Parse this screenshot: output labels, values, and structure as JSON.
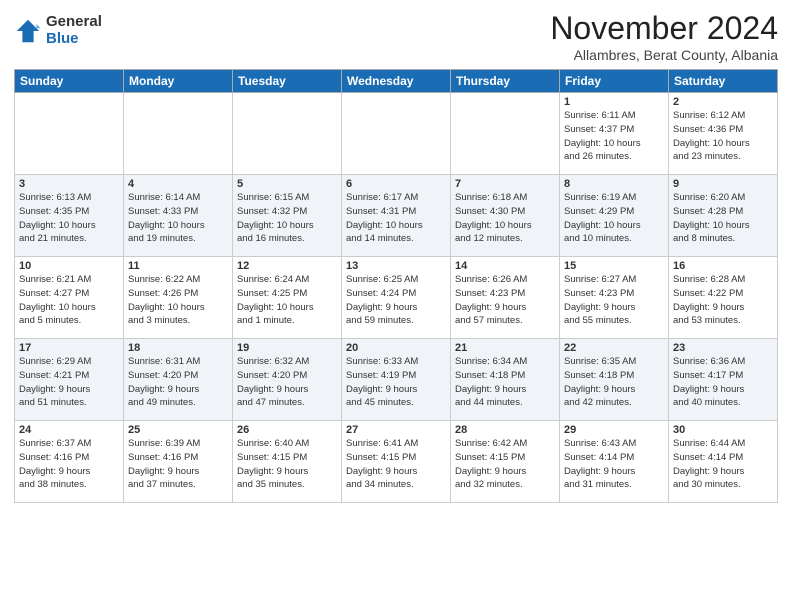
{
  "logo": {
    "general": "General",
    "blue": "Blue"
  },
  "header": {
    "month": "November 2024",
    "location": "Allambres, Berat County, Albania"
  },
  "weekdays": [
    "Sunday",
    "Monday",
    "Tuesday",
    "Wednesday",
    "Thursday",
    "Friday",
    "Saturday"
  ],
  "weeks": [
    [
      {
        "day": "",
        "info": ""
      },
      {
        "day": "",
        "info": ""
      },
      {
        "day": "",
        "info": ""
      },
      {
        "day": "",
        "info": ""
      },
      {
        "day": "",
        "info": ""
      },
      {
        "day": "1",
        "info": "Sunrise: 6:11 AM\nSunset: 4:37 PM\nDaylight: 10 hours\nand 26 minutes."
      },
      {
        "day": "2",
        "info": "Sunrise: 6:12 AM\nSunset: 4:36 PM\nDaylight: 10 hours\nand 23 minutes."
      }
    ],
    [
      {
        "day": "3",
        "info": "Sunrise: 6:13 AM\nSunset: 4:35 PM\nDaylight: 10 hours\nand 21 minutes."
      },
      {
        "day": "4",
        "info": "Sunrise: 6:14 AM\nSunset: 4:33 PM\nDaylight: 10 hours\nand 19 minutes."
      },
      {
        "day": "5",
        "info": "Sunrise: 6:15 AM\nSunset: 4:32 PM\nDaylight: 10 hours\nand 16 minutes."
      },
      {
        "day": "6",
        "info": "Sunrise: 6:17 AM\nSunset: 4:31 PM\nDaylight: 10 hours\nand 14 minutes."
      },
      {
        "day": "7",
        "info": "Sunrise: 6:18 AM\nSunset: 4:30 PM\nDaylight: 10 hours\nand 12 minutes."
      },
      {
        "day": "8",
        "info": "Sunrise: 6:19 AM\nSunset: 4:29 PM\nDaylight: 10 hours\nand 10 minutes."
      },
      {
        "day": "9",
        "info": "Sunrise: 6:20 AM\nSunset: 4:28 PM\nDaylight: 10 hours\nand 8 minutes."
      }
    ],
    [
      {
        "day": "10",
        "info": "Sunrise: 6:21 AM\nSunset: 4:27 PM\nDaylight: 10 hours\nand 5 minutes."
      },
      {
        "day": "11",
        "info": "Sunrise: 6:22 AM\nSunset: 4:26 PM\nDaylight: 10 hours\nand 3 minutes."
      },
      {
        "day": "12",
        "info": "Sunrise: 6:24 AM\nSunset: 4:25 PM\nDaylight: 10 hours\nand 1 minute."
      },
      {
        "day": "13",
        "info": "Sunrise: 6:25 AM\nSunset: 4:24 PM\nDaylight: 9 hours\nand 59 minutes."
      },
      {
        "day": "14",
        "info": "Sunrise: 6:26 AM\nSunset: 4:23 PM\nDaylight: 9 hours\nand 57 minutes."
      },
      {
        "day": "15",
        "info": "Sunrise: 6:27 AM\nSunset: 4:23 PM\nDaylight: 9 hours\nand 55 minutes."
      },
      {
        "day": "16",
        "info": "Sunrise: 6:28 AM\nSunset: 4:22 PM\nDaylight: 9 hours\nand 53 minutes."
      }
    ],
    [
      {
        "day": "17",
        "info": "Sunrise: 6:29 AM\nSunset: 4:21 PM\nDaylight: 9 hours\nand 51 minutes."
      },
      {
        "day": "18",
        "info": "Sunrise: 6:31 AM\nSunset: 4:20 PM\nDaylight: 9 hours\nand 49 minutes."
      },
      {
        "day": "19",
        "info": "Sunrise: 6:32 AM\nSunset: 4:20 PM\nDaylight: 9 hours\nand 47 minutes."
      },
      {
        "day": "20",
        "info": "Sunrise: 6:33 AM\nSunset: 4:19 PM\nDaylight: 9 hours\nand 45 minutes."
      },
      {
        "day": "21",
        "info": "Sunrise: 6:34 AM\nSunset: 4:18 PM\nDaylight: 9 hours\nand 44 minutes."
      },
      {
        "day": "22",
        "info": "Sunrise: 6:35 AM\nSunset: 4:18 PM\nDaylight: 9 hours\nand 42 minutes."
      },
      {
        "day": "23",
        "info": "Sunrise: 6:36 AM\nSunset: 4:17 PM\nDaylight: 9 hours\nand 40 minutes."
      }
    ],
    [
      {
        "day": "24",
        "info": "Sunrise: 6:37 AM\nSunset: 4:16 PM\nDaylight: 9 hours\nand 38 minutes."
      },
      {
        "day": "25",
        "info": "Sunrise: 6:39 AM\nSunset: 4:16 PM\nDaylight: 9 hours\nand 37 minutes."
      },
      {
        "day": "26",
        "info": "Sunrise: 6:40 AM\nSunset: 4:15 PM\nDaylight: 9 hours\nand 35 minutes."
      },
      {
        "day": "27",
        "info": "Sunrise: 6:41 AM\nSunset: 4:15 PM\nDaylight: 9 hours\nand 34 minutes."
      },
      {
        "day": "28",
        "info": "Sunrise: 6:42 AM\nSunset: 4:15 PM\nDaylight: 9 hours\nand 32 minutes."
      },
      {
        "day": "29",
        "info": "Sunrise: 6:43 AM\nSunset: 4:14 PM\nDaylight: 9 hours\nand 31 minutes."
      },
      {
        "day": "30",
        "info": "Sunrise: 6:44 AM\nSunset: 4:14 PM\nDaylight: 9 hours\nand 30 minutes."
      }
    ]
  ]
}
